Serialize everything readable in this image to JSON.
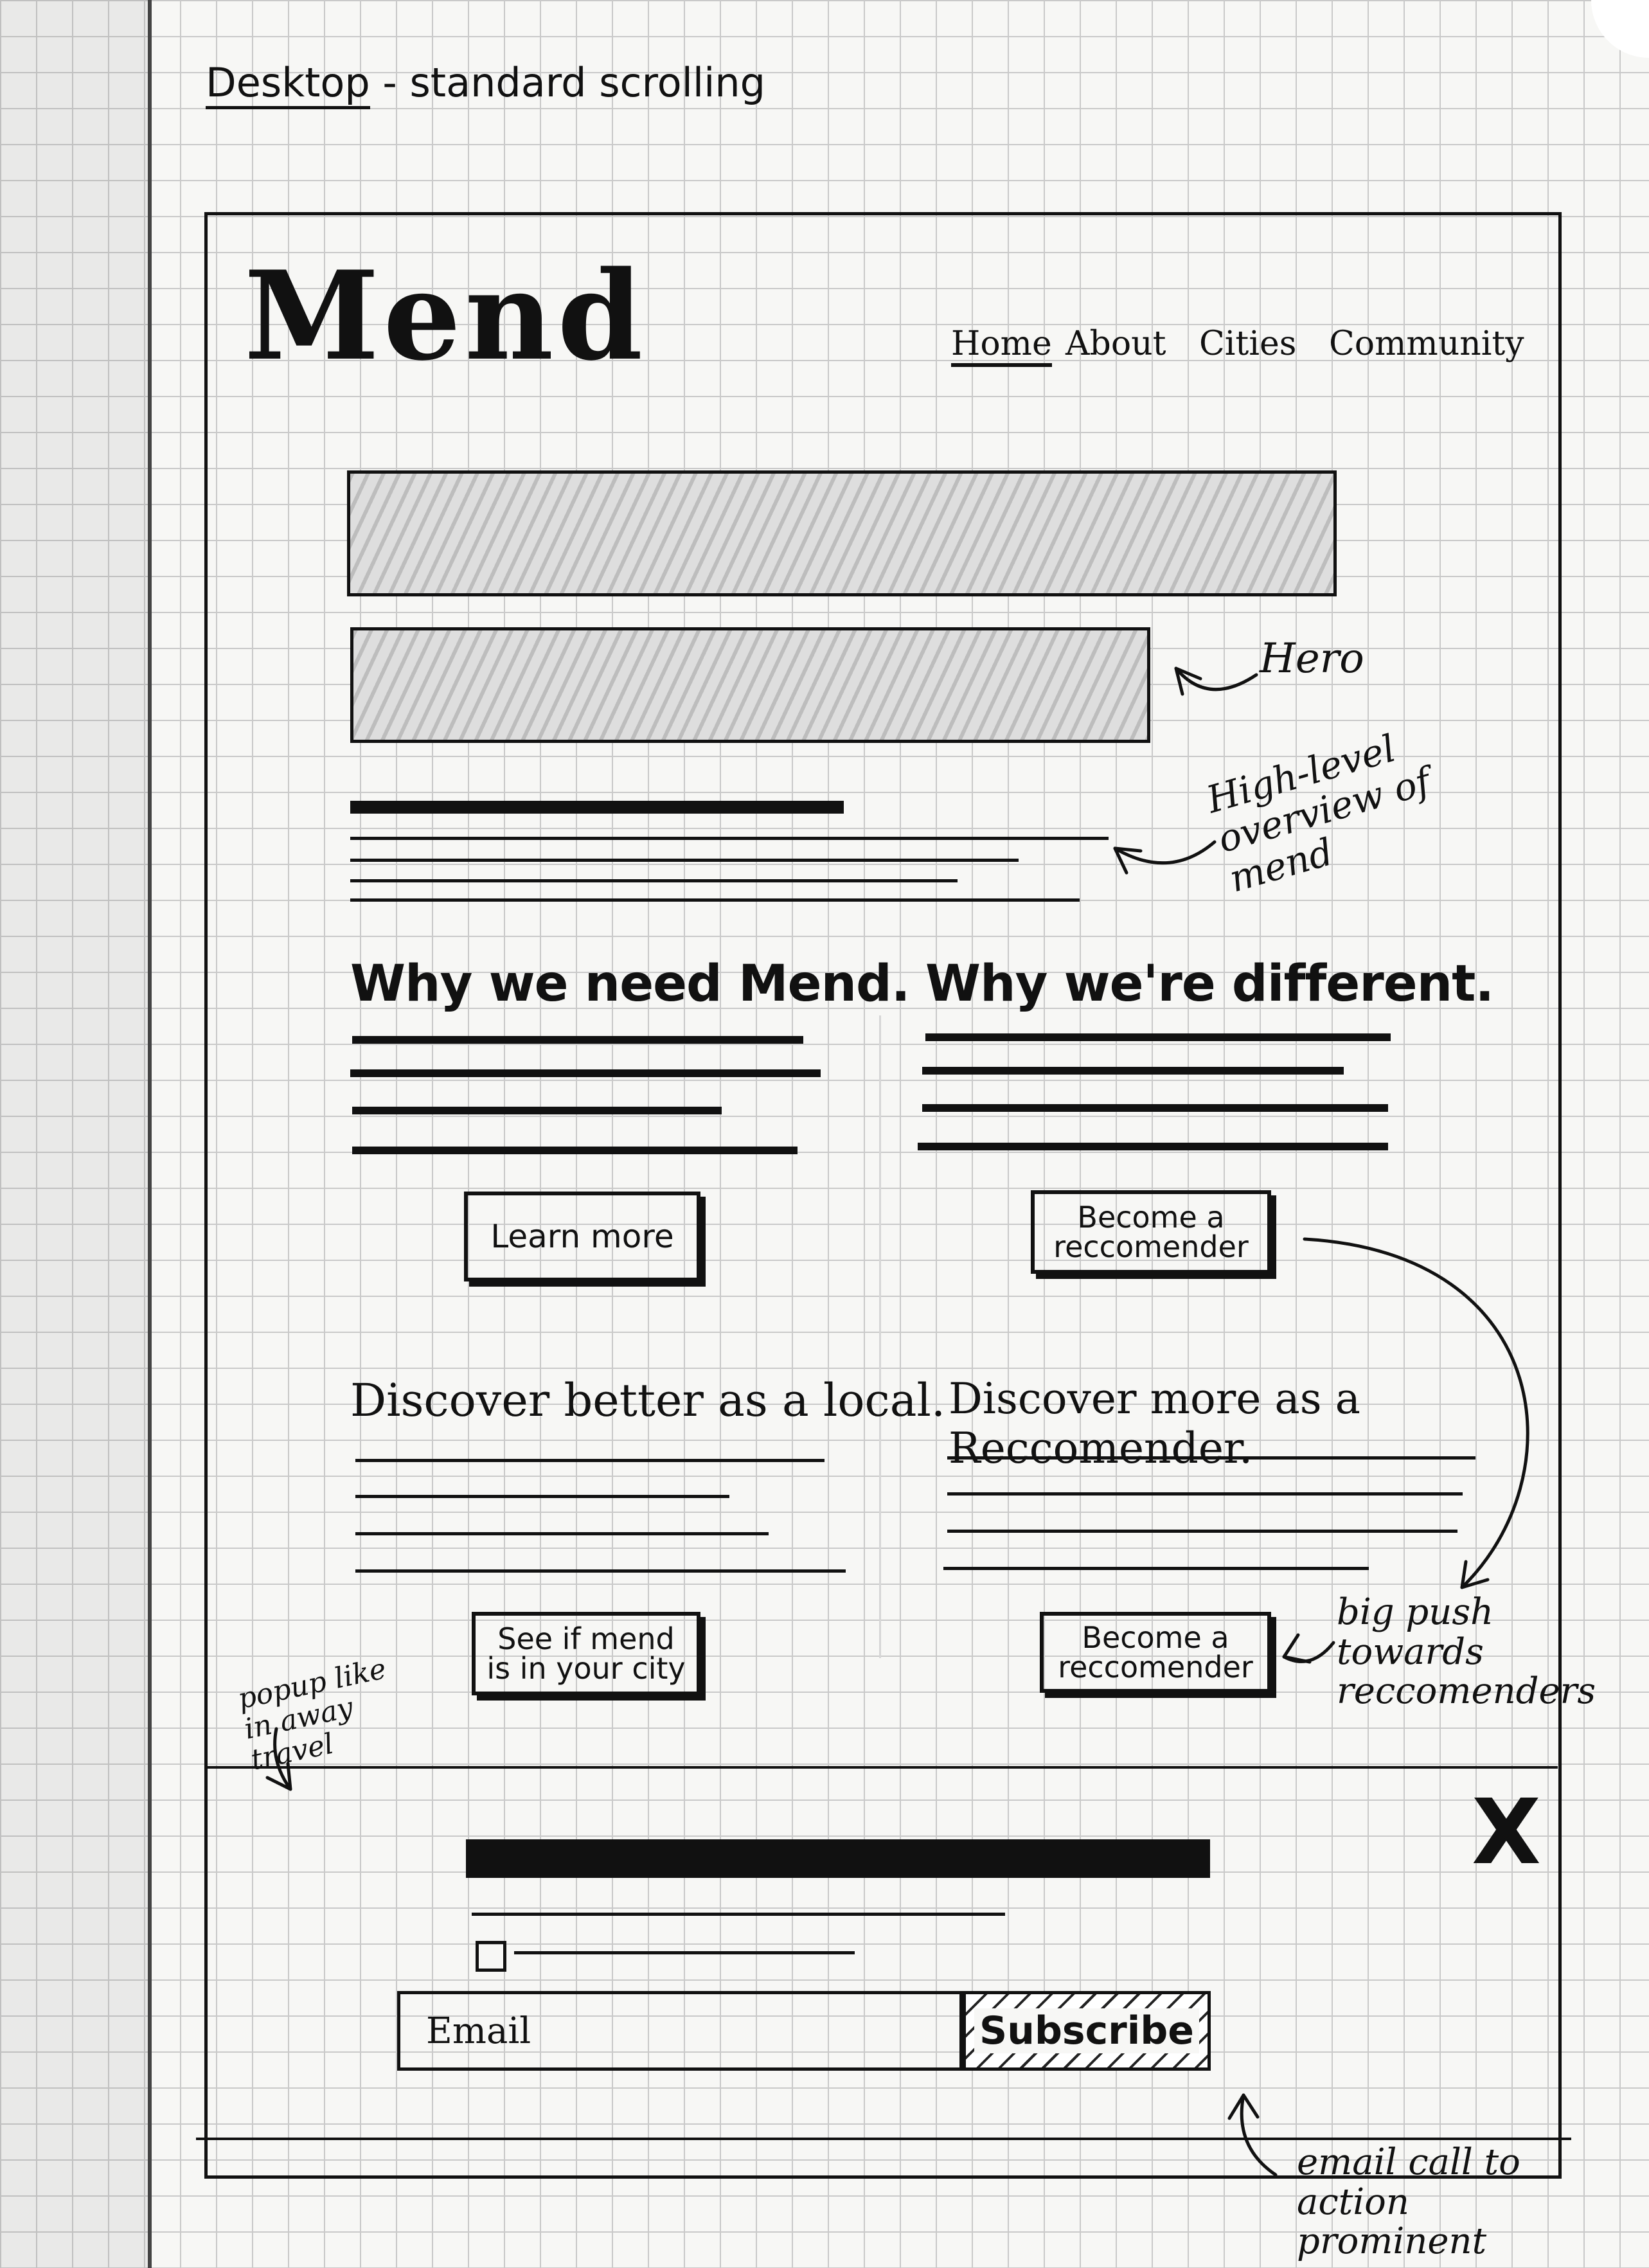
{
  "page_label": {
    "prefix": "Desktop",
    "rest": "- standard scrolling"
  },
  "logo": "Mend",
  "nav": [
    "Home",
    "About",
    "Cities",
    "Community"
  ],
  "sections": [
    {
      "heading": "Why we need Mend.",
      "button": "Learn more"
    },
    {
      "heading": "Why we're different.",
      "button": "Become a reccomender"
    }
  ],
  "discover": [
    {
      "heading": "Discover better as a local.",
      "button": "See if mend is in your city"
    },
    {
      "heading": "Discover more as a Reccomender.",
      "button": "Become a reccomender"
    }
  ],
  "popup": {
    "close": "X",
    "email_placeholder": "Email",
    "subscribe": "Subscribe"
  },
  "annotations": {
    "hero": "Hero",
    "overview": "High-level overview of mend",
    "push": "big push towards reccomenders",
    "popup": "popup like in away travel",
    "email": "email call to action prominent"
  }
}
